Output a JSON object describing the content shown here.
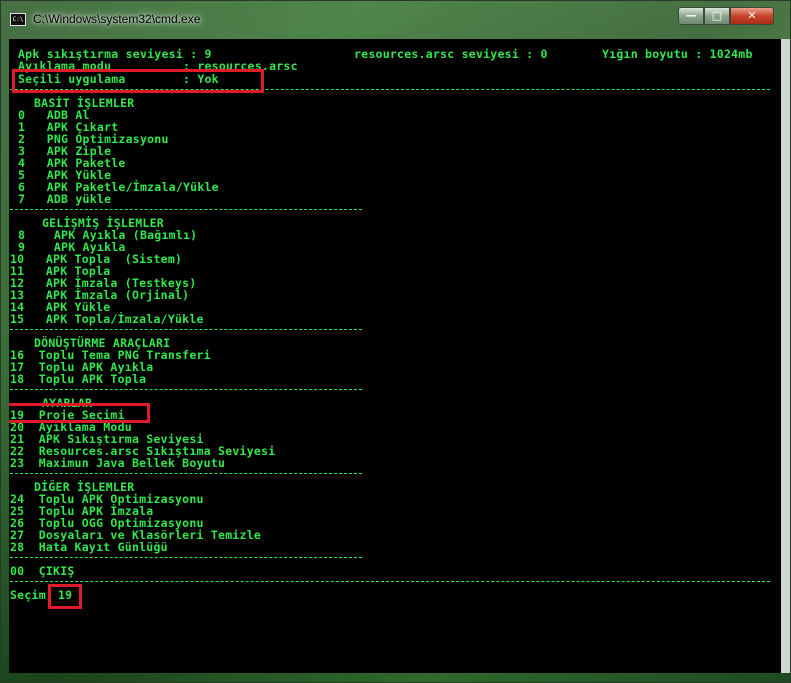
{
  "window": {
    "title": "C:\\Windows\\system32\\cmd.exe",
    "icon_label": "C:\\",
    "buttons": {
      "minimize": "—",
      "maximize": "□",
      "close": "✕"
    }
  },
  "colors": {
    "text": "#32e84c",
    "highlight": "#e11a2a",
    "background": "#000000"
  },
  "status": {
    "compression": "Apk sıkıştırma seviyesi : 9",
    "resources": "resources.arsc seviyesi : 0",
    "heap": "Yığın boyutu : 1024mb",
    "debug_mode": "Ayıklama modu          : resources.arsc",
    "selected_app": "Seçili uygulama        : Yok"
  },
  "sections": {
    "basic": {
      "title": "BASİT İŞLEMLER",
      "items": [
        "0   ADB Al",
        "1   APK Çıkart",
        "2   PNG Optimizasyonu",
        "3   APK Ziple",
        "4   APK Paketle",
        "5   APK Yükle",
        "6   APK Paketle/İmzala/Yükle",
        "7   ADB yükle"
      ]
    },
    "advanced": {
      "title": "GELİŞMİŞ İŞLEMLER",
      "items": [
        "8    APK Ayıkla (Bağımlı)",
        "9    APK Ayıkla",
        "10   APK Topla  (Sistem)",
        "11   APK Topla",
        "12   APK İmzala (Testkeys)",
        "13   APK İmzala (Orjinal)",
        "14   APK Yükle",
        "15   APK Topla/İmzala/Yükle"
      ]
    },
    "conversion": {
      "title": "DÖNÜŞTÜRME ARAÇLARI",
      "items": [
        "16  Toplu Tema PNG Transferi",
        "17  Toplu APK Ayıkla",
        "18  Toplu APK Topla"
      ]
    },
    "settings": {
      "title": "AYARLAR",
      "items": [
        "19  Proje Seçimi",
        "20  Ayıklama Modu",
        "21  APK Sıkıştırma Seviyesi",
        "22  Resources.arsc Sıkıştıma Seviyesi",
        "23  Maximun Java Bellek Boyutu"
      ]
    },
    "other": {
      "title": "DİĞER İŞLEMLER",
      "items": [
        "24  Toplu APK Optimizasyonu",
        "25  Toplu APK İmzala",
        "26  Toplu OGG Optimizasyonu",
        "27  Dosyaları ve Klasörleri Temizle",
        "28  Hata Kayıt Günlüğü"
      ]
    }
  },
  "exit": "00  ÇIKIŞ",
  "prompt": {
    "label": "Seçim:",
    "value": "19"
  }
}
